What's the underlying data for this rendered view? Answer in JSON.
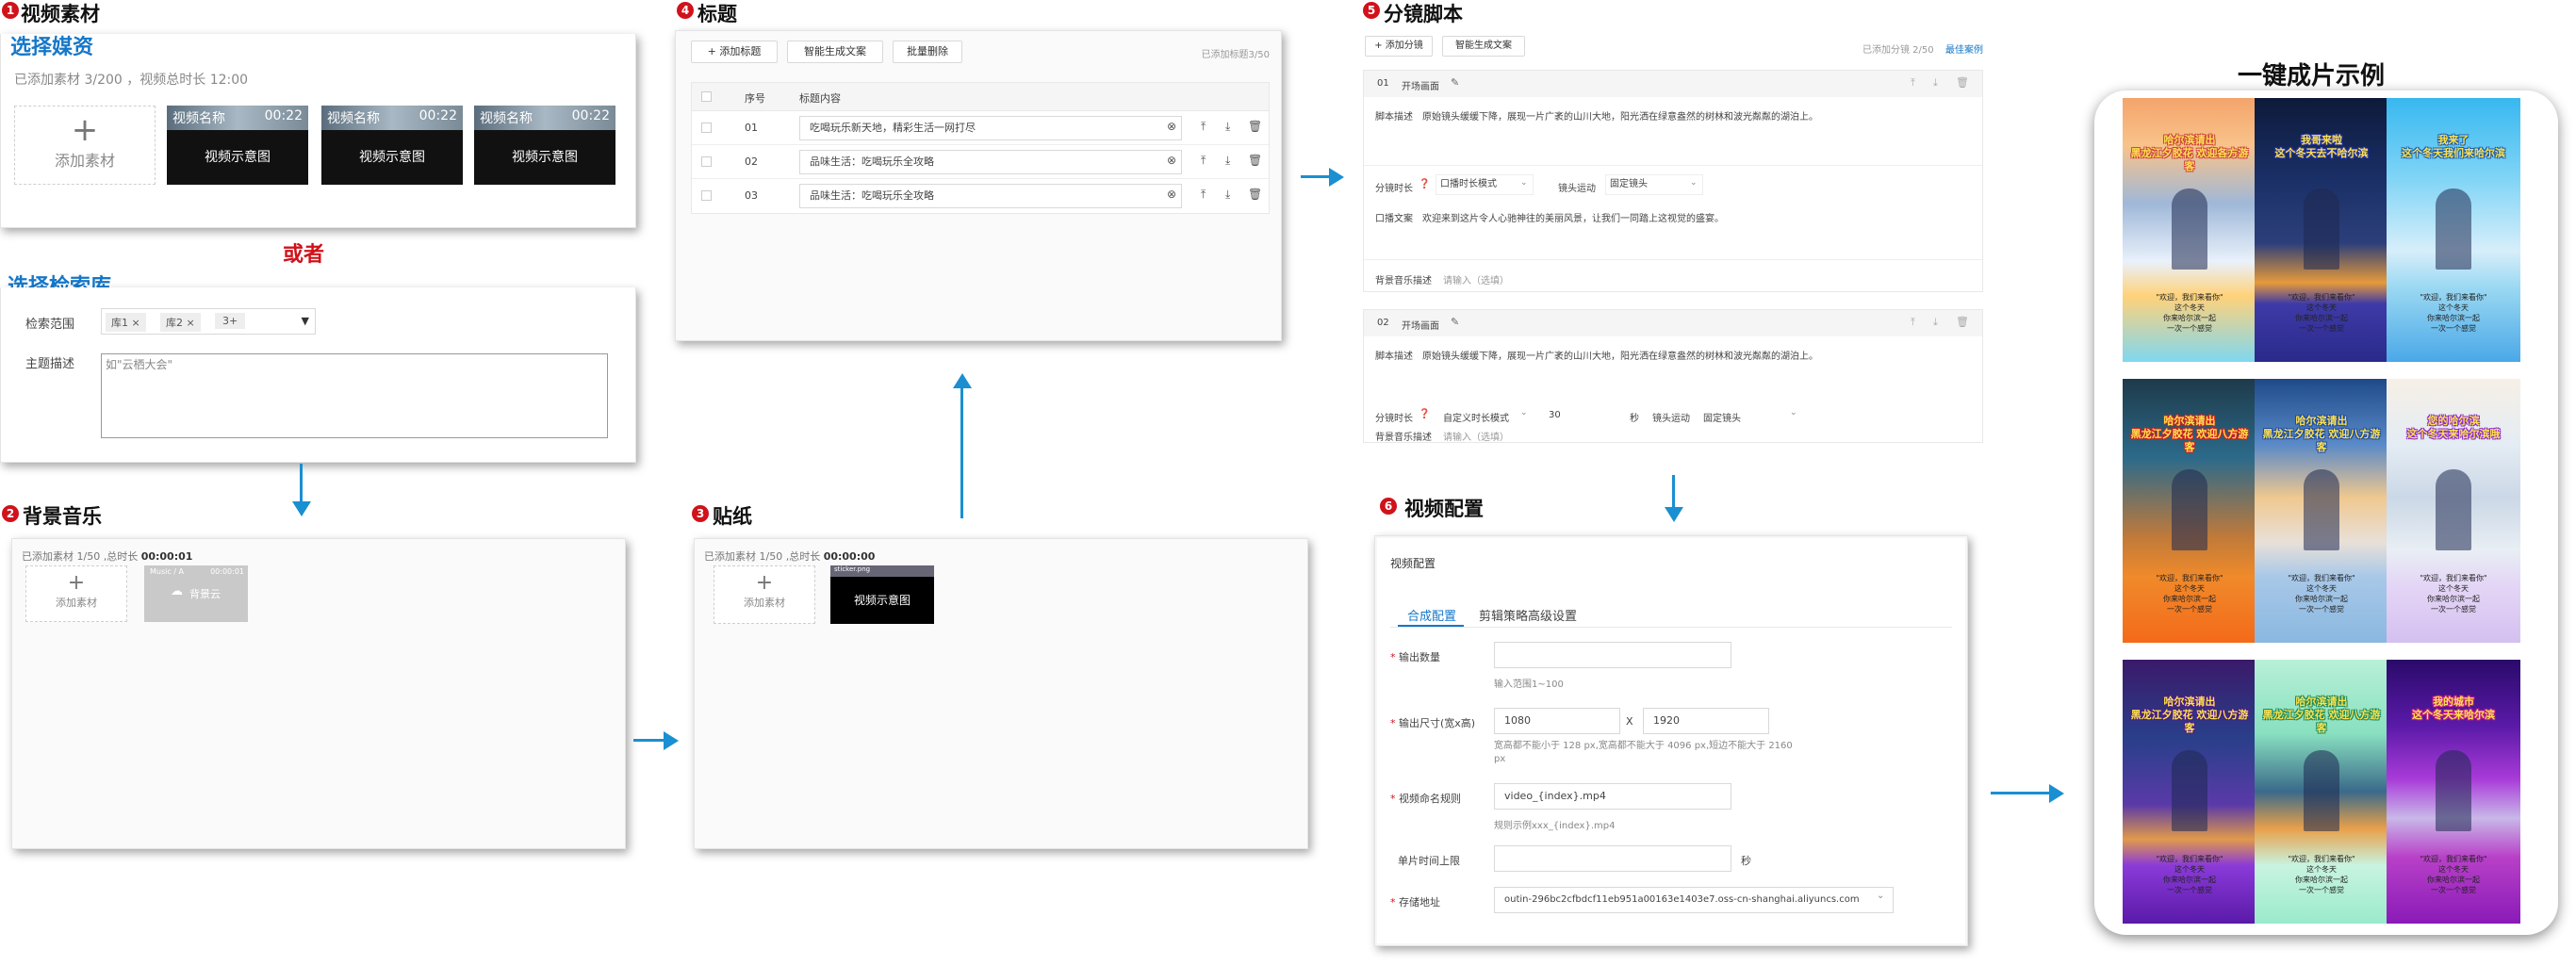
{
  "step1": {
    "badge": "1",
    "title": "视频素材",
    "media_heading": "选择媒资",
    "summary": "已添加素材 3/200 ，视频总时长 12:00",
    "add_label": "添加素材",
    "tiles": [
      {
        "name": "视频名称",
        "duration": "00:22",
        "caption": "视频示意图"
      },
      {
        "name": "视频名称",
        "duration": "00:22",
        "caption": "视频示意图"
      },
      {
        "name": "视频名称",
        "duration": "00:22",
        "caption": "视频示意图"
      }
    ],
    "or_text": "或者",
    "library_heading": "选择检索库",
    "scope_label": "检索范围",
    "scope_tags": [
      "库1 ×",
      "库2 ×",
      "3+"
    ],
    "topic_label": "主题描述",
    "topic_placeholder": "如\"云栖大会\""
  },
  "step2": {
    "badge": "2",
    "title": "背景音乐",
    "summary_prefix": "已添加素材 1/50 ,总时长 ",
    "summary_duration": "00:00:01",
    "add_label": "添加素材",
    "tile_title": "Music / A",
    "tile_duration": "00:00:01",
    "tile_caption": "背景云"
  },
  "step3": {
    "badge": "3",
    "title": "贴纸",
    "summary_prefix": "已添加素材 1/50 ,总时长 ",
    "summary_duration": "00:00:00",
    "add_label": "添加素材",
    "tile_title": "sticker.png",
    "tile_caption": "视频示意图"
  },
  "step4": {
    "badge": "4",
    "title": "标题",
    "buttons": [
      "+ 添加标题",
      "智能生成文案",
      "批量删除"
    ],
    "count": "已添加标题3/50",
    "col_index": "序号",
    "col_content": "标题内容",
    "rows": [
      {
        "index": "01",
        "text": "吃喝玩乐新天地，精彩生活一网打尽"
      },
      {
        "index": "02",
        "text": "品味生活：吃喝玩乐全攻略"
      },
      {
        "index": "03",
        "text": "品味生活：吃喝玩乐全攻略"
      }
    ]
  },
  "step5": {
    "badge": "5",
    "title": "分镜脚本",
    "add_btn": "+ 添加分镜",
    "ai_btn": "智能生成文案",
    "count": "已添加分镜 2/50",
    "best_link": "最佳案例",
    "shots": [
      {
        "no": "01",
        "name": "开场画面",
        "desc_label": "脚本描述",
        "desc": "原始镜头缓缓下降，展现一片广袤的山川大地，阳光洒在绿意盎然的树林和波光粼粼的湖泊上。",
        "duration_label": "分镜时长",
        "duration_mode": "口播时长模式",
        "camera_label": "镜头运动",
        "camera_value": "固定镜头",
        "voice_label": "口播文案",
        "voice_text": "欢迎来到这片令人心驰神往的美丽风景，让我们一同踏上这视觉的盛宴。",
        "bgm_label": "背景音乐描述",
        "bgm_placeholder": "请输入（选填）"
      },
      {
        "no": "02",
        "name": "开场画面",
        "desc_label": "脚本描述",
        "desc": "原始镜头缓缓下降，展现一片广袤的山川大地，阳光洒在绿意盎然的树林和波光粼粼的湖泊上。",
        "duration_label": "分镜时长",
        "duration_mode": "自定义时长模式",
        "duration_value": "30",
        "duration_unit": "秒",
        "camera_label": "镜头运动",
        "camera_value": "固定镜头",
        "bgm_label": "背景音乐描述",
        "bgm_placeholder": "请输入（选填）"
      }
    ]
  },
  "step6": {
    "badge": "6",
    "title": "视频配置",
    "panel_title": "视频配置",
    "tabs": [
      "合成配置",
      "剪辑策略高级设置"
    ],
    "fields": {
      "count_label": "输出数量",
      "count_hint": "输入范围1~100",
      "size_label": "输出尺寸(宽x高)",
      "width": "1080",
      "times": "X",
      "height": "1920",
      "size_hint": "宽高都不能小于 128 px,宽高都不能大于 4096 px,短边不能大于 2160 px",
      "naming_label": "视频命名规则",
      "naming_value": "video_{index}.mp4",
      "naming_hint": "规则示例xxx_{index}.mp4",
      "maxlen_label": "单片时间上限",
      "maxlen_unit": "秒",
      "storage_label": "存储地址",
      "storage_value": "outin-296bc2cfbdcf11eb951a00163e1403e7.oss-cn-shanghai.aliyuncs.com"
    }
  },
  "gallery": {
    "title": "一键成片示例",
    "posters": [
      {
        "title": "哈尔滨请出\n黑龙江夕胶花 欢迎各方游客",
        "style": "snow-sunset"
      },
      {
        "title": "我哥来啦\n这个冬天去不哈尔滨",
        "style": "night-church"
      },
      {
        "title": "我来了\n这个冬天我们来哈尔滨",
        "style": "blue-sky"
      },
      {
        "title": "哈尔滨请出\n黑龙江夕胶花 欢迎八方游客",
        "style": "church-orange"
      },
      {
        "title": "哈尔滨请出\n黑龙江夕胶花 欢迎八方游客",
        "style": "mountain-sun"
      },
      {
        "title": "您的哈尔滨\n这个冬天来哈尔滨哦",
        "style": "snow-tree"
      },
      {
        "title": "哈尔滨请出\n黑龙江夕胶花 欢迎八方游客",
        "style": "church-purple"
      },
      {
        "title": "哈尔滨请出\n黑龙江夕胶花 欢迎八方游客",
        "style": "church-green"
      },
      {
        "title": "我的城市\n这个冬天来哈尔滨",
        "style": "mountain-purple"
      }
    ],
    "poster_sub": "\"欢迎，我们来看你\"\n这个冬天\n你来哈尔滨一起\n一次一个感觉"
  }
}
